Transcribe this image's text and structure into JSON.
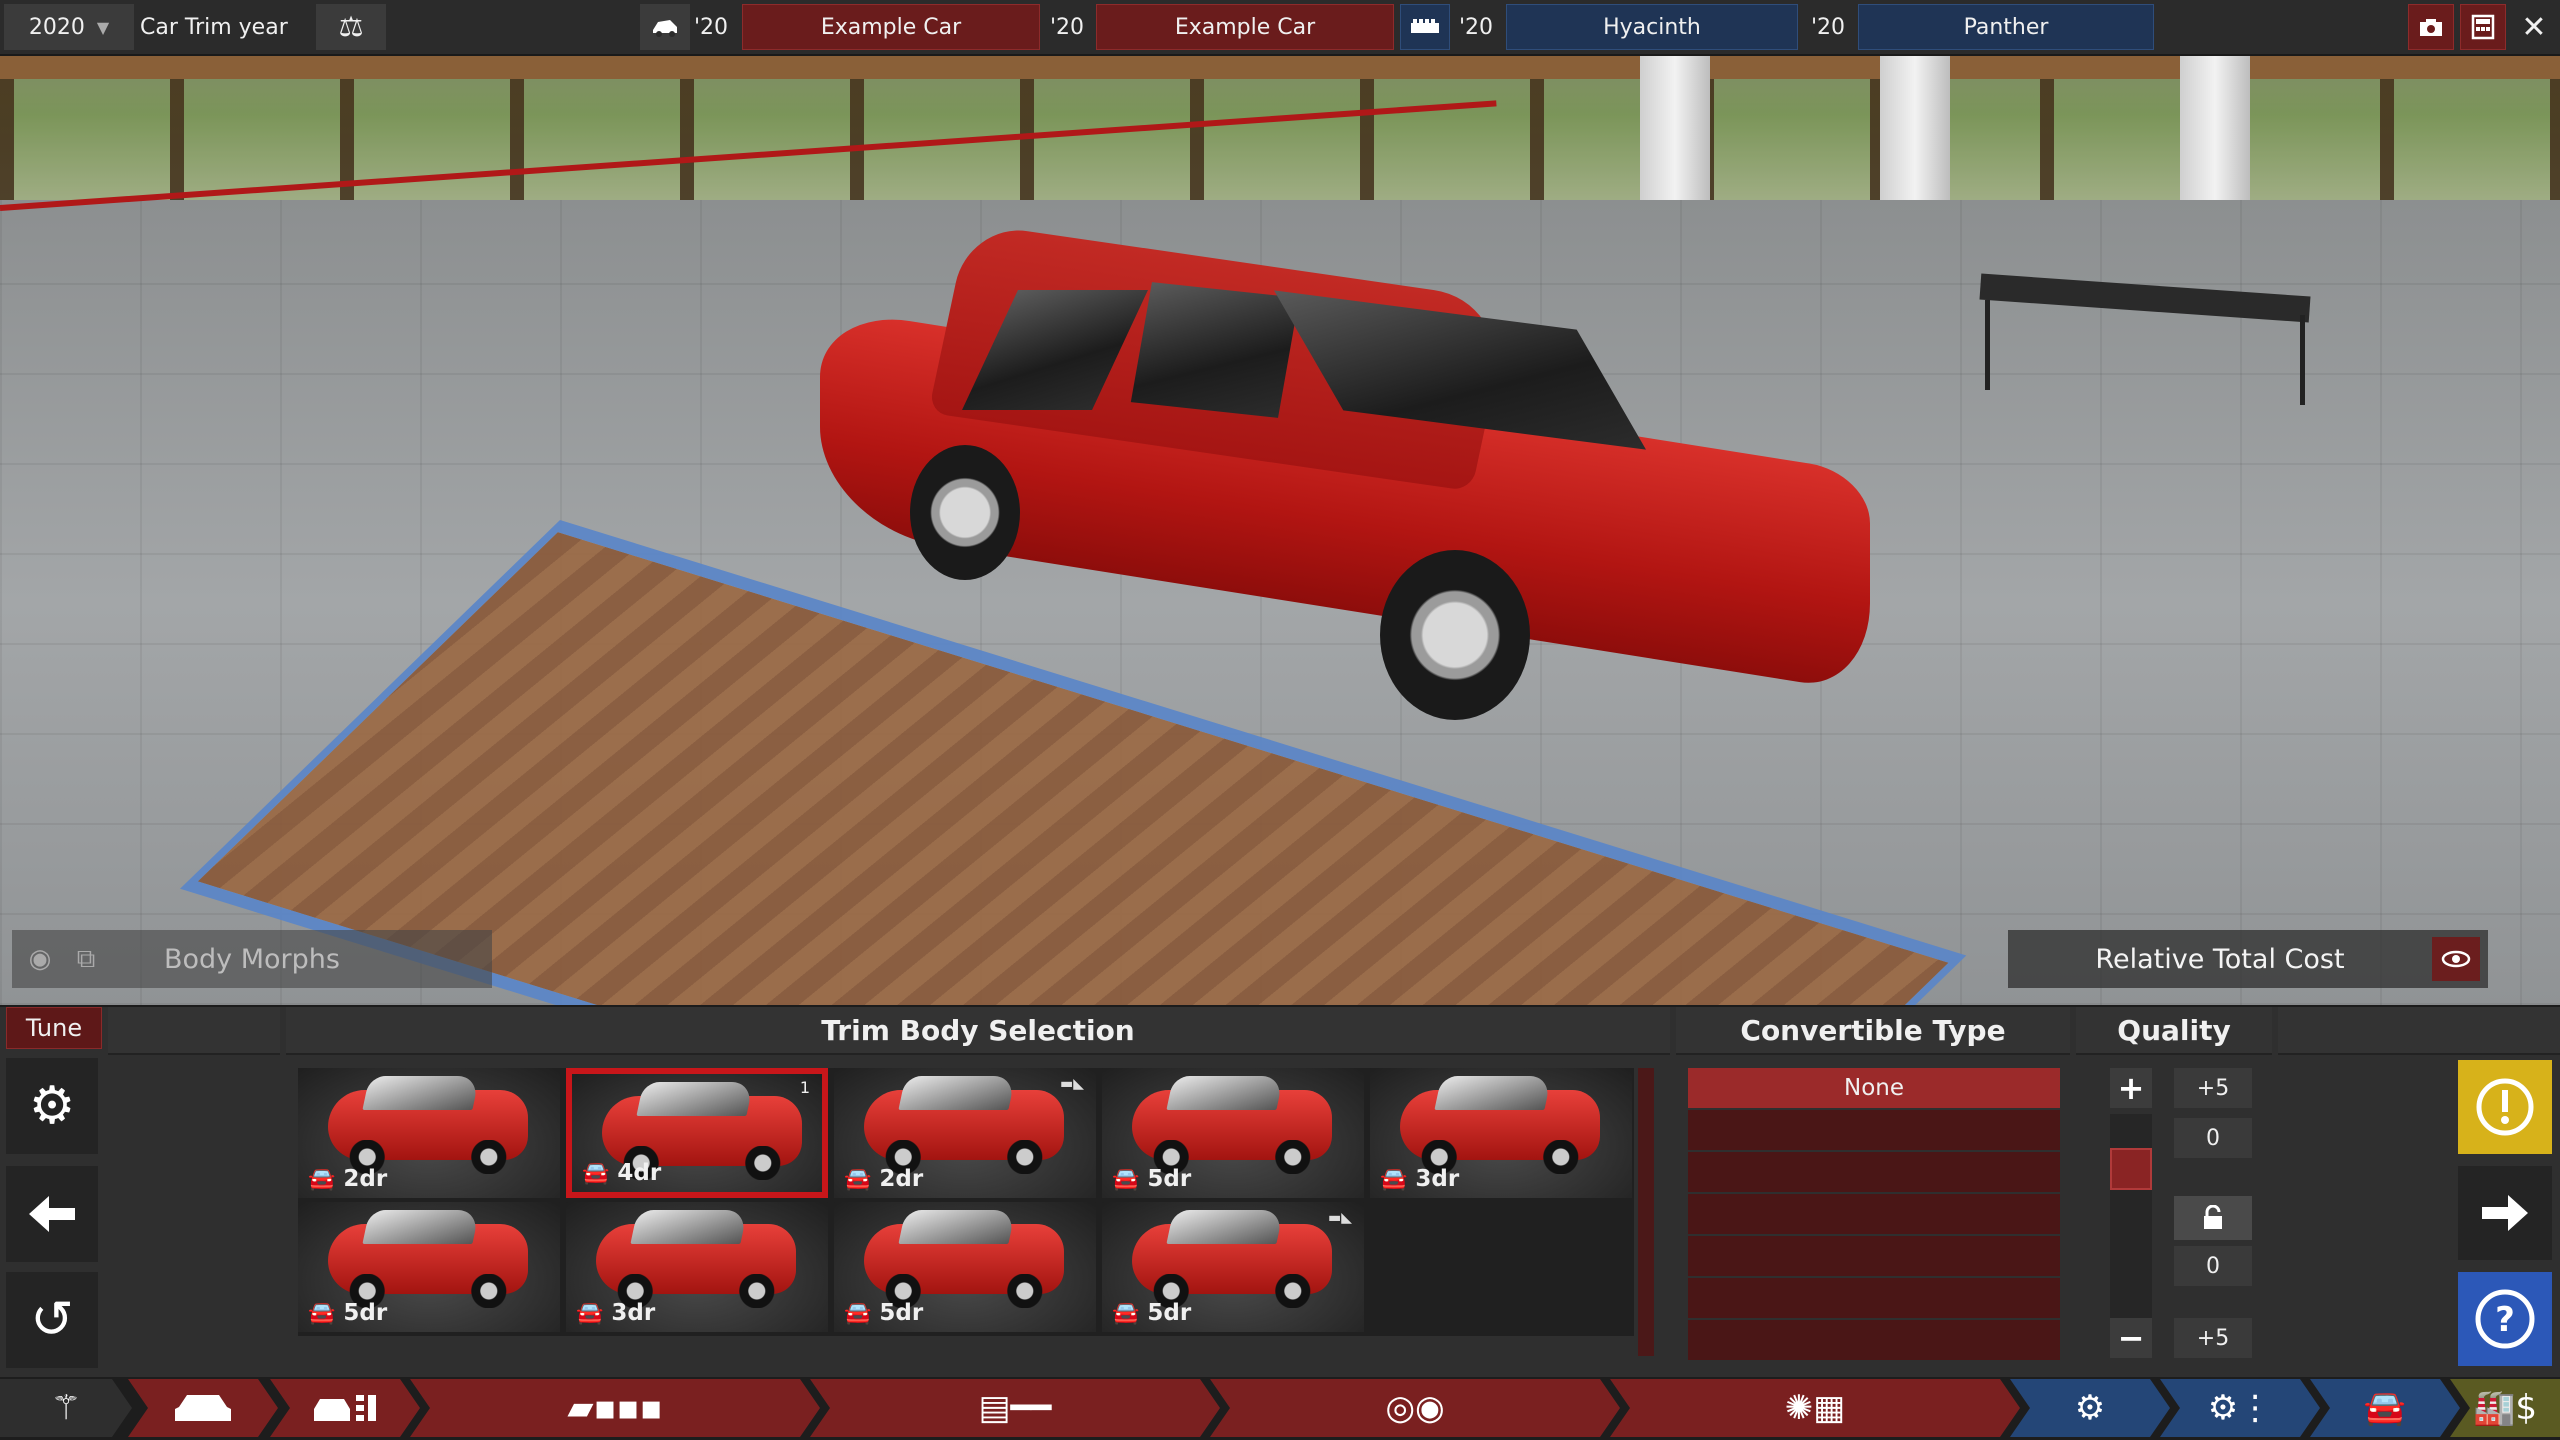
{
  "topbar": {
    "year": "2020",
    "year_dropdown_arrow": "▼",
    "trim_year_label": "Car Trim year",
    "icons": {
      "balance": "balance-icon",
      "car": "car-icon",
      "engine": "engine-icon",
      "camera": "camera-icon",
      "calculator": "calculator-icon",
      "close": "close-icon"
    },
    "model_year": "'20",
    "model_name": "Example Car",
    "trim_year": "'20",
    "trim_name": "Example Car",
    "engine_family_year": "'20",
    "engine_family_name": "Hyacinth",
    "engine_variant_year": "'20",
    "engine_variant_name": "Panther",
    "close_glyph": "✕"
  },
  "scene": {
    "morphs_label": "Body Morphs",
    "relative_cost_label": "Relative Total Cost"
  },
  "panel": {
    "tune_tab": "Tune",
    "trim_header": "Trim Body Selection",
    "convertible_header": "Convertible Type",
    "quality_header": "Quality",
    "bodies": [
      {
        "label": "2dr",
        "selected": false,
        "badge": "",
        "convertible": false
      },
      {
        "label": "4dr",
        "selected": true,
        "badge": "1",
        "convertible": false
      },
      {
        "label": "2dr",
        "selected": false,
        "badge": "",
        "convertible": true
      },
      {
        "label": "5dr",
        "selected": false,
        "badge": "",
        "convertible": false
      },
      {
        "label": "3dr",
        "selected": false,
        "badge": "",
        "convertible": false
      },
      {
        "label": "5dr",
        "selected": false,
        "badge": "",
        "convertible": false
      },
      {
        "label": "3dr",
        "selected": false,
        "badge": "",
        "convertible": false
      },
      {
        "label": "5dr",
        "selected": false,
        "badge": "",
        "convertible": false
      },
      {
        "label": "5dr",
        "selected": false,
        "badge": "",
        "convertible": true
      }
    ],
    "convertible_options": [
      "None"
    ],
    "quality": {
      "plus": "+",
      "minus": "−",
      "max_label": "+5",
      "current_label": "0",
      "lock_value": "0",
      "min_label": "+5",
      "slider_level": 0.17
    }
  },
  "colors": {
    "accent_red": "#7a2020",
    "selected_red": "#c8161a",
    "blue": "#244677",
    "warning": "#d7b21a",
    "help": "#2c58b8"
  }
}
